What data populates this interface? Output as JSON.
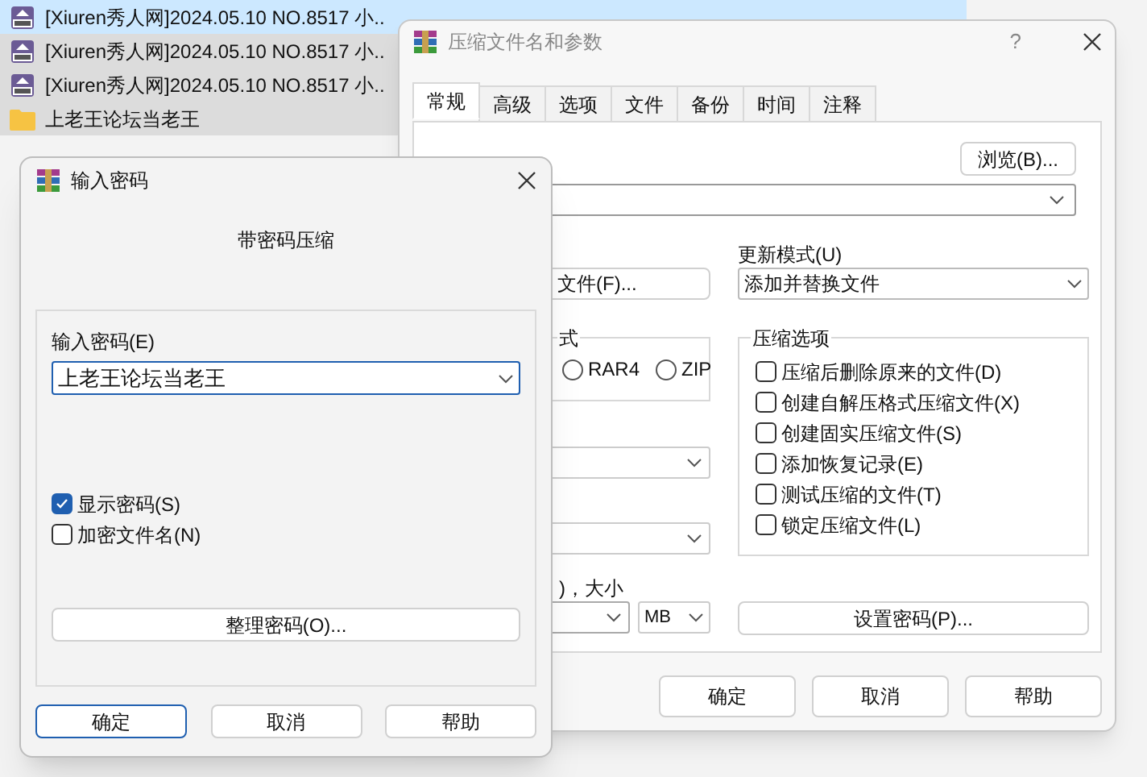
{
  "file_list": [
    {
      "kind": "rar",
      "name": "[Xiuren秀人网]2024.05.10 NO.8517 小..",
      "selected": true
    },
    {
      "kind": "rar",
      "name": "[Xiuren秀人网]2024.05.10 NO.8517 小..",
      "selected": false
    },
    {
      "kind": "rar",
      "name": "[Xiuren秀人网]2024.05.10 NO.8517 小..",
      "selected": false
    },
    {
      "kind": "folder",
      "name": "上老王论坛当老王",
      "selected": false
    }
  ],
  "archive_dialog": {
    "title": "压缩文件名和参数",
    "help": "?",
    "tabs": [
      {
        "label": "常规",
        "selected": true
      },
      {
        "label": "高级",
        "selected": false
      },
      {
        "label": "选项",
        "selected": false
      },
      {
        "label": "文件",
        "selected": false
      },
      {
        "label": "备份",
        "selected": false
      },
      {
        "label": "时间",
        "selected": false
      },
      {
        "label": "注释",
        "selected": false
      }
    ],
    "browse_button": "浏览(B)...",
    "files_button": "文件(F)...",
    "update_mode": {
      "label": "更新模式(U)",
      "value": "添加并替换文件"
    },
    "format_group": {
      "label": "式",
      "options": [
        {
          "label": "RAR4",
          "selected": false
        },
        {
          "label": "ZIP",
          "selected": false
        }
      ]
    },
    "options_group": {
      "label": "压缩选项",
      "items": [
        {
          "label": "压缩后删除原来的文件(D)",
          "checked": false
        },
        {
          "label": "创建自解压格式压缩文件(X)",
          "checked": false
        },
        {
          "label": "创建固实压缩文件(S)",
          "checked": false
        },
        {
          "label": "添加恢复记录(E)",
          "checked": false
        },
        {
          "label": "测试压缩的文件(T)",
          "checked": false
        },
        {
          "label": "锁定压缩文件(L)",
          "checked": false
        }
      ]
    },
    "split_label": ")，大小",
    "split_unit": "MB",
    "password_button": "设置密码(P)...",
    "buttons": [
      {
        "label": "确定",
        "default": false
      },
      {
        "label": "取消",
        "default": false
      },
      {
        "label": "帮助",
        "default": false
      }
    ]
  },
  "password_dialog": {
    "title": "输入密码",
    "heading": "带密码压缩",
    "password": {
      "label": "输入密码(E)",
      "value": "上老王论坛当老王"
    },
    "checkboxes": [
      {
        "label": "显示密码(S)",
        "checked": true
      },
      {
        "label": "加密文件名(N)",
        "checked": false
      }
    ],
    "organize_button": "整理密码(O)...",
    "buttons": [
      {
        "label": "确定",
        "default": true
      },
      {
        "label": "取消",
        "default": false
      },
      {
        "label": "帮助",
        "default": false
      }
    ]
  }
}
